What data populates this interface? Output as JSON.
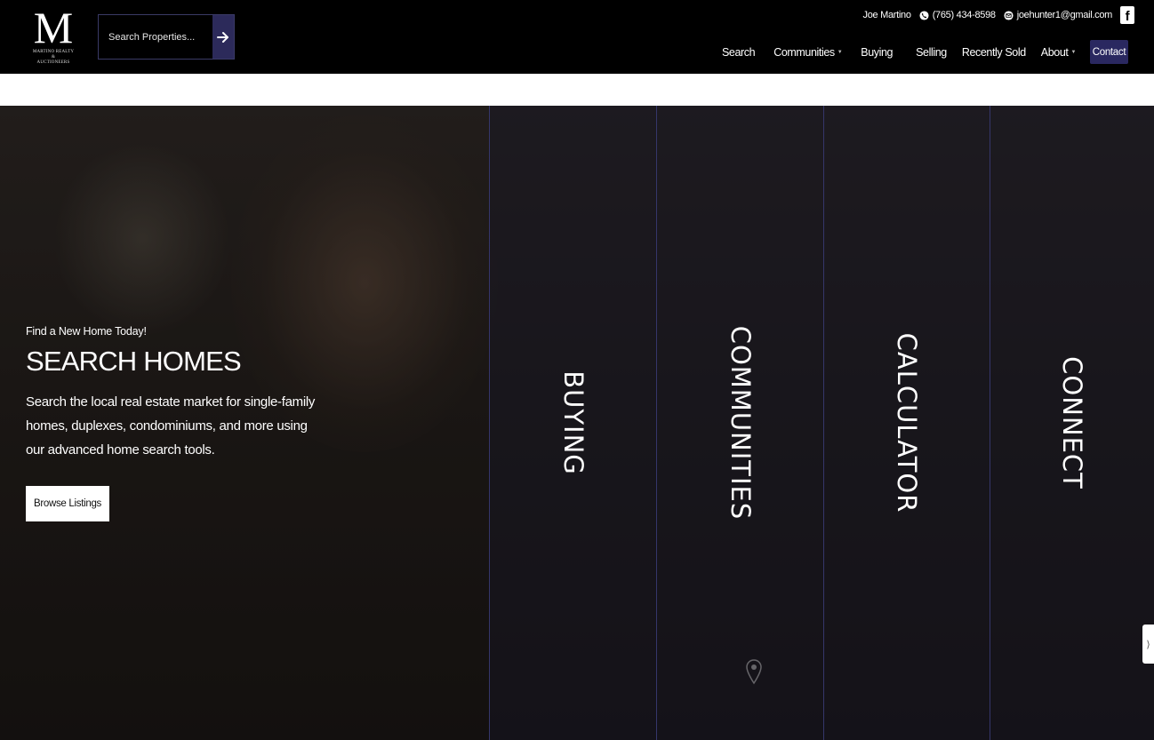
{
  "header": {
    "logo": {
      "letter": "M",
      "line1": "MARTINO REALTY",
      "line2": "&",
      "line3": "AUCTIONEERS"
    },
    "search": {
      "placeholder": "Search Properties..."
    },
    "contact_bar": {
      "name": "Joe Martino",
      "phone": "(765) 434-8598",
      "email": "joehunter1@gmail.com",
      "social": "f"
    },
    "nav": {
      "items": [
        "Search",
        "Communities",
        "Buying",
        "Selling",
        "Recently Sold",
        "About"
      ],
      "contact": "Contact"
    }
  },
  "hero": {
    "tagline": "Find a New Home Today!",
    "title": "SEARCH HOMES",
    "description": "Search the local real estate market for single-family homes, duplexes,  condominiums, and more using our advanced home search tools.",
    "cta": "Browse Listings",
    "panels": [
      "BUYING",
      "COMMUNITIES",
      "CALCULATOR",
      "CONNECT"
    ]
  },
  "colors": {
    "header_bg": "#000000",
    "accent": "#2a2860",
    "panel_border": "#35366a"
  }
}
